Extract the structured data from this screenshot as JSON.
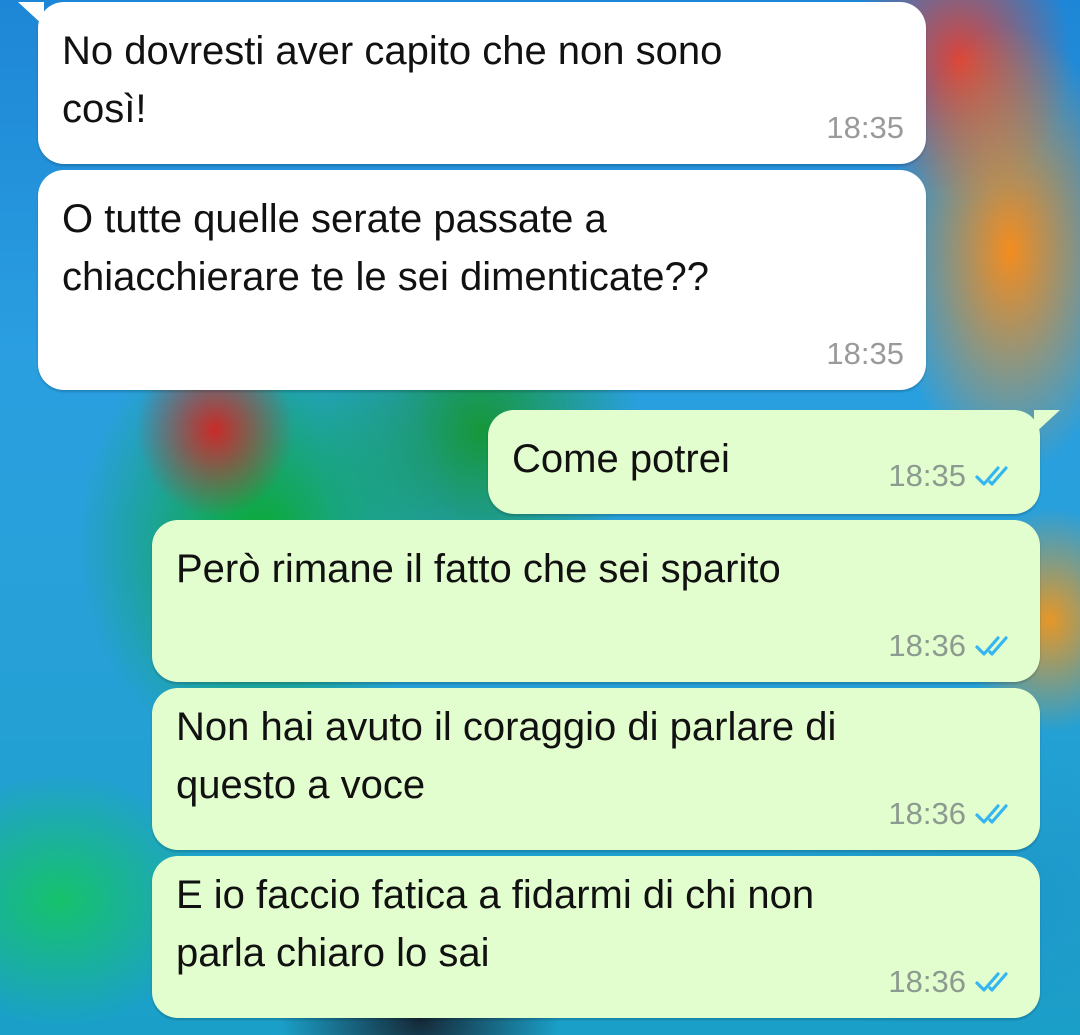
{
  "colors": {
    "incoming_bubble": "#ffffff",
    "outgoing_bubble": "#e2fdce",
    "read_ticks": "#34b7f1",
    "timestamp": "#8c9a8f"
  },
  "messages": [
    {
      "direction": "incoming",
      "text": "No dovresti aver capito che non sono\ncosì!",
      "time": "18:35"
    },
    {
      "direction": "incoming",
      "text": "O tutte quelle serate passate a\nchiacchierare te le sei dimenticate??",
      "time": "18:35"
    },
    {
      "direction": "outgoing",
      "text": "Come potrei",
      "time": "18:35",
      "status": "read"
    },
    {
      "direction": "outgoing",
      "text": "Però rimane il fatto che sei sparito",
      "time": "18:36",
      "status": "read"
    },
    {
      "direction": "outgoing",
      "text": "Non hai avuto il coraggio di parlare di\nquesto a voce",
      "time": "18:36",
      "status": "read"
    },
    {
      "direction": "outgoing",
      "text": "E io faccio fatica a fidarmi di chi non\nparla chiaro lo sai",
      "time": "18:36",
      "status": "read"
    }
  ],
  "icons": {
    "read_receipt": "double-check-icon"
  }
}
